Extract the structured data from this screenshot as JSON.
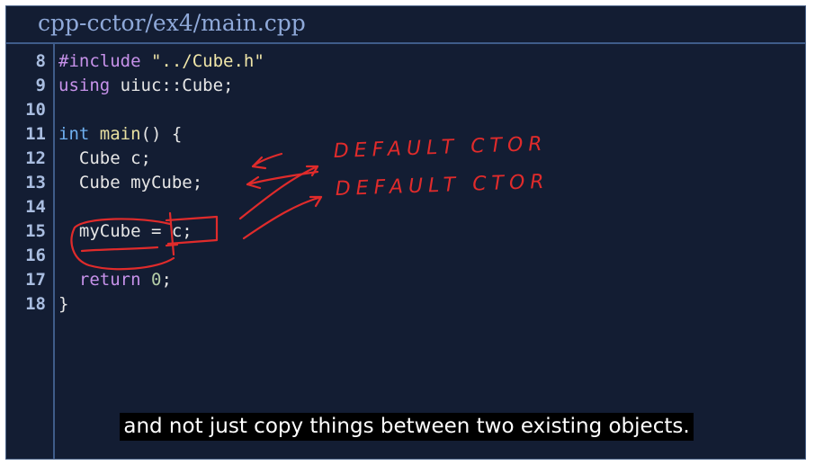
{
  "title": "cpp-cctor/ex4/main.cpp",
  "code_lines": [
    {
      "number": "8",
      "parts": [
        {
          "t": "#include",
          "c": "kw"
        },
        {
          "t": " ",
          "c": "plain"
        },
        {
          "t": "\"../Cube.h\"",
          "c": "str"
        }
      ]
    },
    {
      "number": "9",
      "parts": [
        {
          "t": "using",
          "c": "kw"
        },
        {
          "t": " uiuc::Cube;",
          "c": "plain"
        }
      ]
    },
    {
      "number": "10",
      "parts": []
    },
    {
      "number": "11",
      "parts": [
        {
          "t": "int",
          "c": "kw2"
        },
        {
          "t": " ",
          "c": "plain"
        },
        {
          "t": "main",
          "c": "fn"
        },
        {
          "t": "() {",
          "c": "plain"
        }
      ]
    },
    {
      "number": "12",
      "parts": [
        {
          "t": "  Cube c;",
          "c": "plain"
        }
      ]
    },
    {
      "number": "13",
      "parts": [
        {
          "t": "  Cube myCube;",
          "c": "plain"
        }
      ]
    },
    {
      "number": "14",
      "parts": []
    },
    {
      "number": "15",
      "parts": [
        {
          "t": "  myCube = c;",
          "c": "plain"
        }
      ]
    },
    {
      "number": "16",
      "parts": []
    },
    {
      "number": "17",
      "parts": [
        {
          "t": "  ",
          "c": "plain"
        },
        {
          "t": "return",
          "c": "kw"
        },
        {
          "t": " ",
          "c": "plain"
        },
        {
          "t": "0",
          "c": "num"
        },
        {
          "t": ";",
          "c": "plain"
        }
      ]
    },
    {
      "number": "18",
      "parts": [
        {
          "t": "}",
          "c": "plain"
        }
      ]
    }
  ],
  "annotations": {
    "note_1": "DEFAULT CTOR",
    "note_2": "DEFAULT CTOR",
    "color": "#e02b2b"
  },
  "caption": "and not just copy things between two existing objects.",
  "colors": {
    "background": "#131d33",
    "accent": "#3f5c8a",
    "title": "#8fa9d9"
  }
}
